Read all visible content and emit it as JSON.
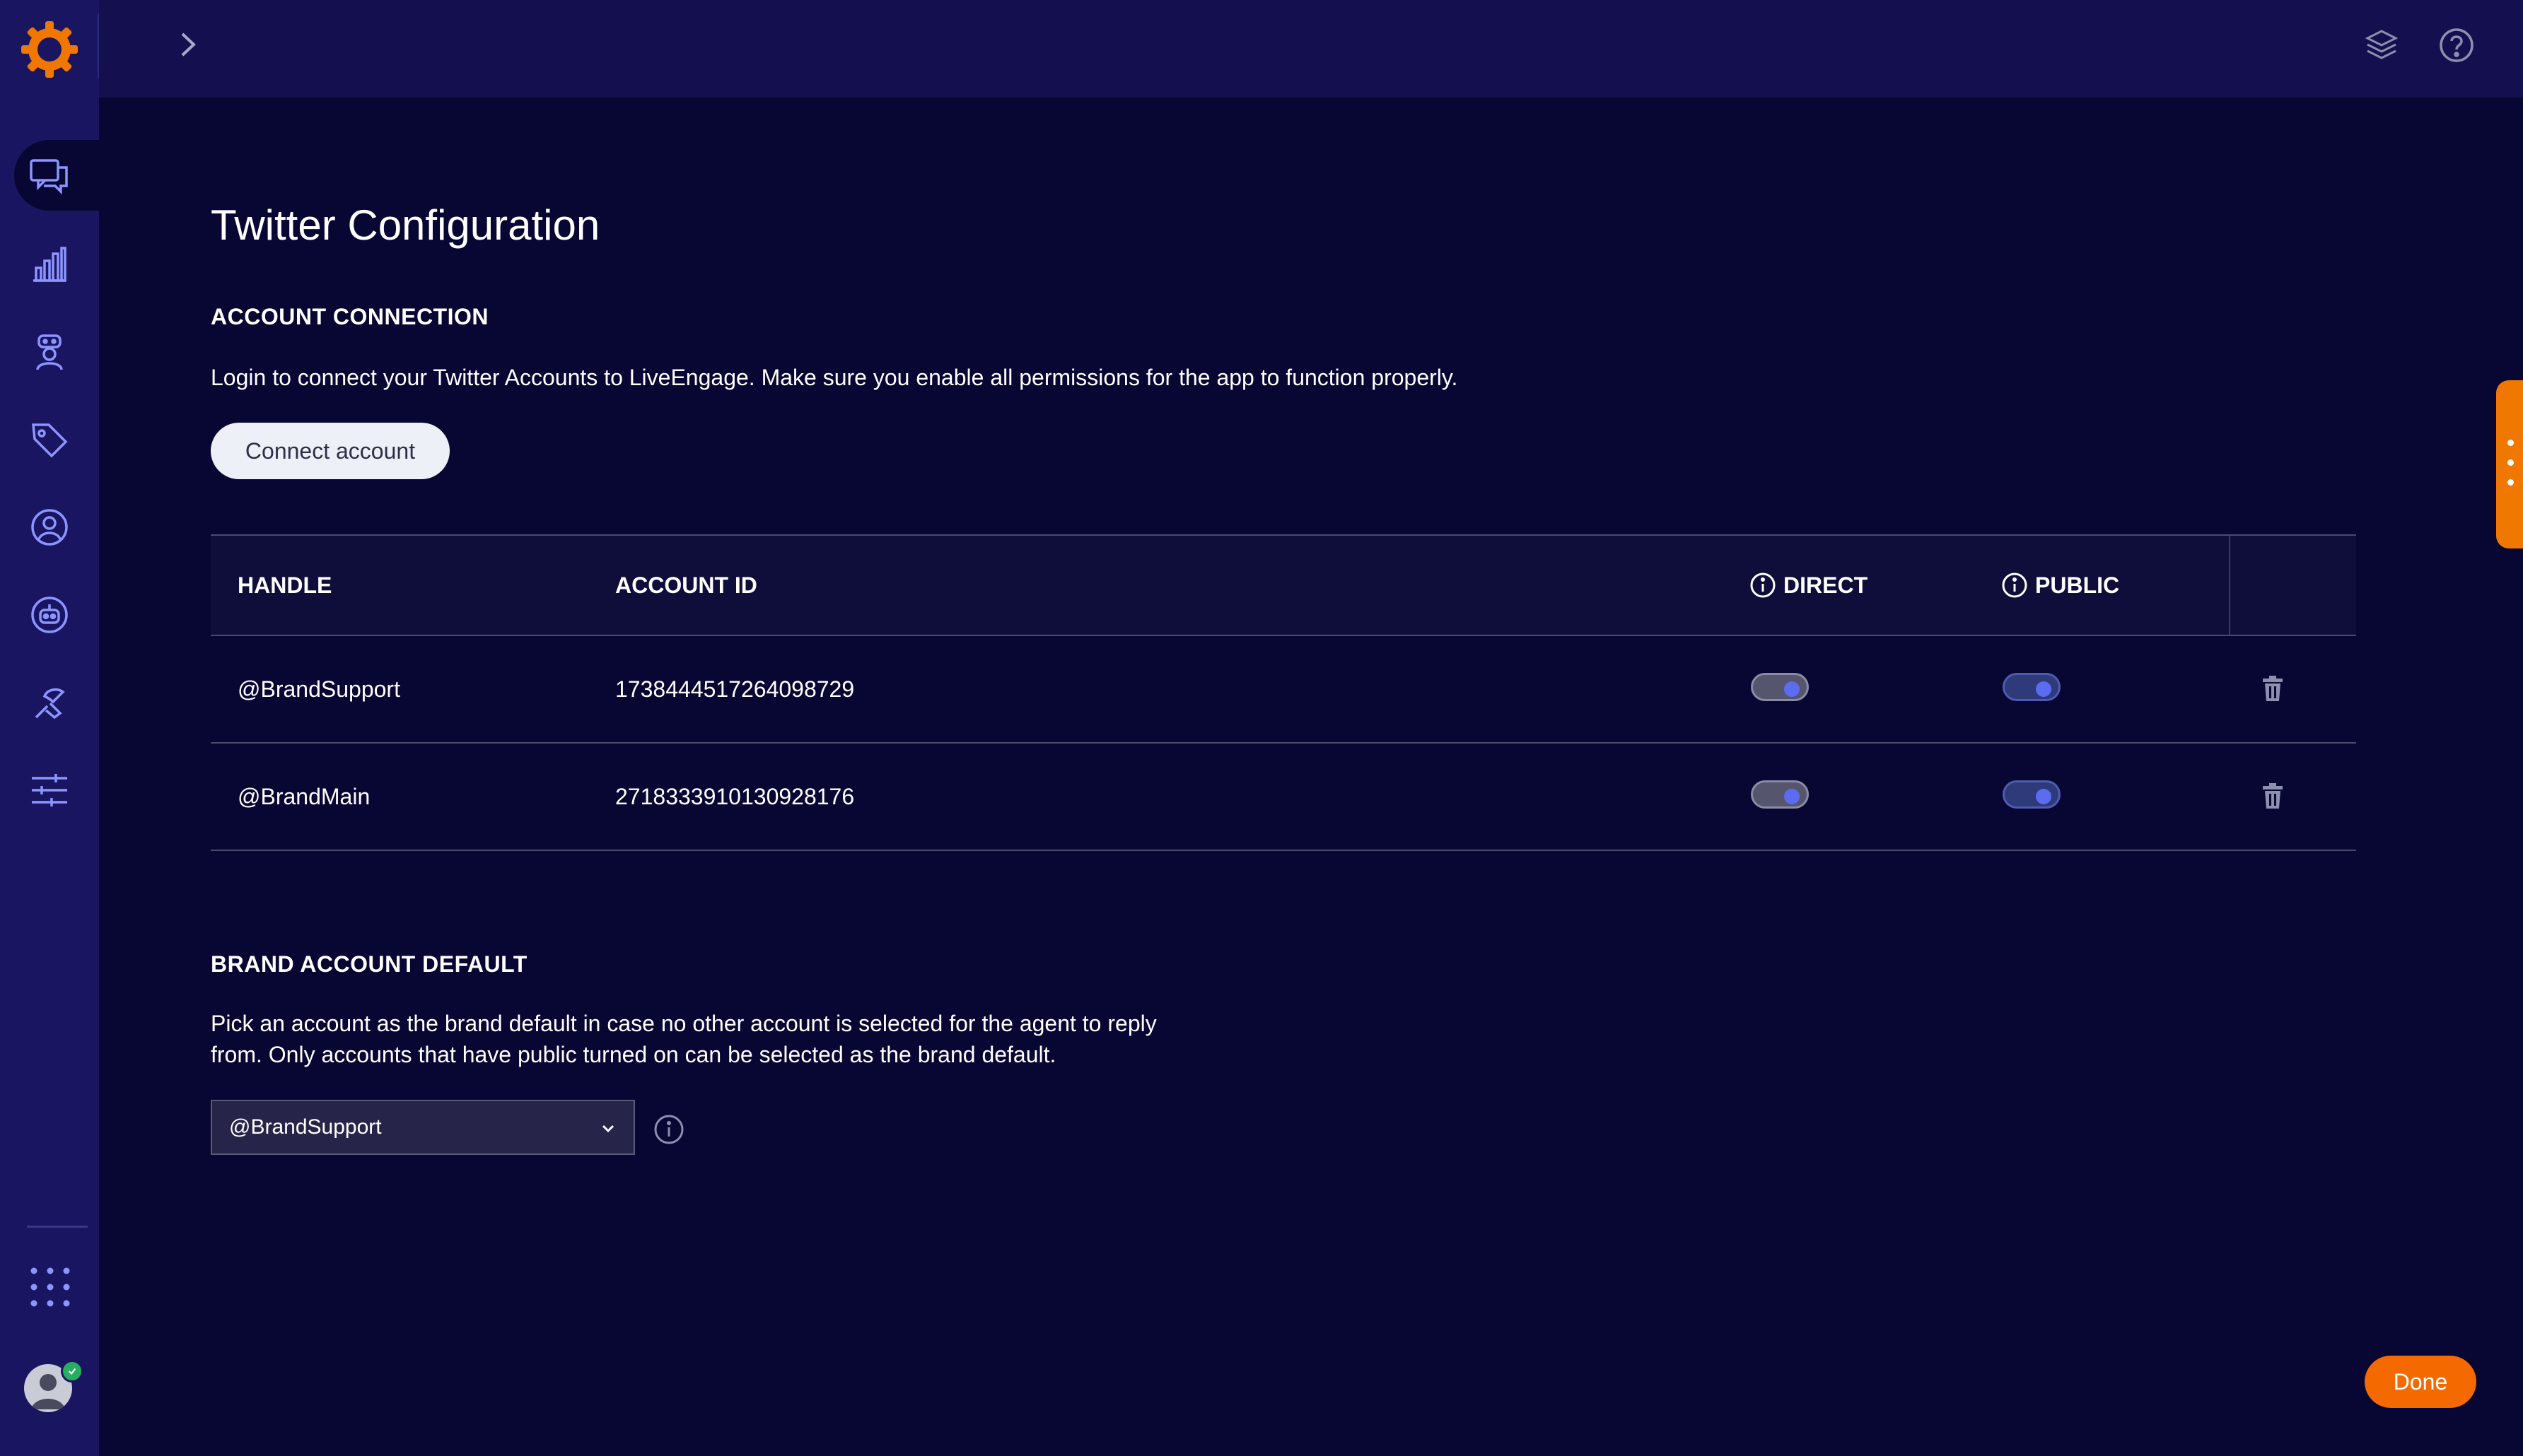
{
  "sidebar": {
    "items": [
      {
        "icon": "conversations-icon",
        "active": true
      },
      {
        "icon": "analytics-icon"
      },
      {
        "icon": "agent-icon"
      },
      {
        "icon": "tag-icon"
      },
      {
        "icon": "user-icon"
      },
      {
        "icon": "bot-icon"
      },
      {
        "icon": "automation-icon"
      },
      {
        "icon": "settings-sliders-icon"
      }
    ],
    "apps_icon": "apps-grid-icon",
    "avatar_status": "online"
  },
  "header": {
    "expand_icon": "chevron-right-icon",
    "right_icons": [
      "layers-icon",
      "help-icon"
    ]
  },
  "page": {
    "title": "Twitter Configuration",
    "account_connection": {
      "heading": "ACCOUNT CONNECTION",
      "description": "Login to connect your Twitter Accounts to LiveEngage. Make sure you enable all permissions for the app to function properly.",
      "connect_label": "Connect account"
    },
    "table": {
      "headers": {
        "handle": "HANDLE",
        "account_id": "ACCOUNT ID",
        "direct": "DIRECT",
        "public": "PUBLIC"
      },
      "rows": [
        {
          "handle": "@BrandSupport",
          "account_id": "1738444517264098729",
          "direct": true,
          "public": true
        },
        {
          "handle": "@BrandMain",
          "account_id": "2718333910130928176",
          "direct": true,
          "public": true
        }
      ]
    },
    "brand_default": {
      "heading": "BRAND ACCOUNT DEFAULT",
      "description_line1": "Pick an account as the brand default in case no other account is selected for the agent to reply",
      "description_line2": "from. Only accounts that have public turned on can be selected as the brand default.",
      "selected": "@BrandSupport"
    },
    "done_label": "Done"
  },
  "colors": {
    "background": "#080632",
    "sidebar": "#1a1560",
    "accent": "#f56a00",
    "toggle_knob": "#5b6cf0"
  }
}
